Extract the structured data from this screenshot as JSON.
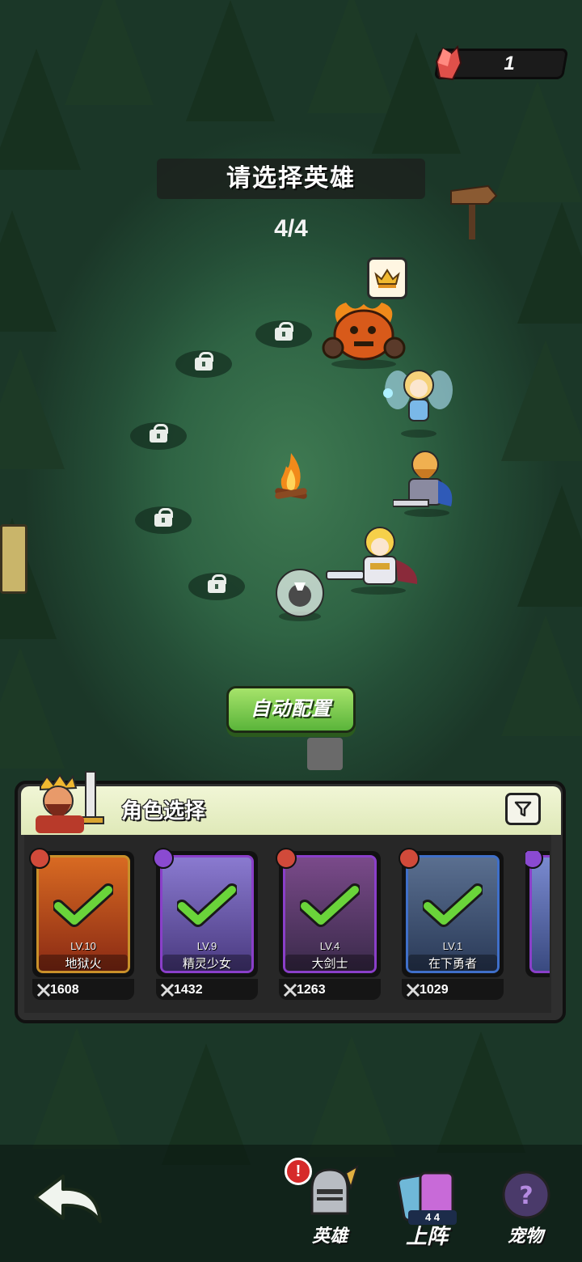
{
  "header": {
    "gem_count": "1",
    "title": "请选择英雄",
    "selected_count": "4/4"
  },
  "actions": {
    "auto_config": "自动配置"
  },
  "panel": {
    "title": "角色选择",
    "cards": [
      {
        "level": "LV.10",
        "name": "地狱火",
        "power": "1608",
        "frame_color": "#c9902a",
        "art_color": "#b8561f",
        "badge_color": "#d14a3a",
        "selected": true
      },
      {
        "level": "LV.9",
        "name": "精灵少女",
        "power": "1432",
        "frame_color": "#8a3fc9",
        "art_color": "#6e5fa8",
        "badge_color": "#8a4ad1",
        "selected": true
      },
      {
        "level": "LV.4",
        "name": "大剑士",
        "power": "1263",
        "frame_color": "#8a3fc9",
        "art_color": "#5a3a6a",
        "badge_color": "#d14a3a",
        "selected": true
      },
      {
        "level": "LV.1",
        "name": "在下勇者",
        "power": "1029",
        "frame_color": "#3f6fc9",
        "art_color": "#44587a",
        "badge_color": "#d14a3a",
        "selected": true
      }
    ]
  },
  "nav": {
    "heroes": "英雄",
    "deploy": "上阵",
    "pets": "宠物",
    "deploy_badge": "4 4",
    "alert": "!"
  },
  "colors": {
    "button_green": "#6fc446",
    "check_green": "#6ad43a",
    "alert_red": "#d62a2a"
  }
}
